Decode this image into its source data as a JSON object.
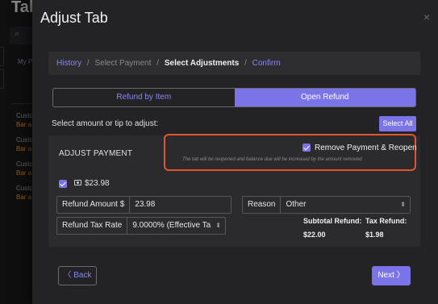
{
  "background": {
    "title": "Tal",
    "search_icon": "search-icon",
    "filter_label": "My P",
    "rows": [
      {
        "line1": "Custo",
        "line2": "Bar a"
      },
      {
        "line1": "Custo",
        "line2": "Bar a"
      },
      {
        "line1": "Custo",
        "line2": "Bar a"
      },
      {
        "line1": "Custo",
        "line2": "Bar a"
      }
    ]
  },
  "modal": {
    "title": "Adjust Tab",
    "close_icon": "×",
    "breadcrumb": {
      "history": "History",
      "sep": "/",
      "select_payment": "Select Payment",
      "select_adjustments": "Select Adjustments",
      "confirm": "Confirm"
    },
    "tabs": {
      "refund_by_item": "Refund by Item",
      "open_refund": "Open Refund",
      "active": "open_refund"
    },
    "select_prompt": "Select amount or tip to adjust:",
    "select_all": "Select All",
    "panel": {
      "heading": "ADJUST PAYMENT",
      "remove_reopen": {
        "label": "Remove Payment & Reopen",
        "checked": true,
        "note": "The tab will be reopened and balance due will be increased by the amount removed."
      },
      "payment": {
        "checked": true,
        "icon": "cash-icon",
        "amount": "$23.98"
      },
      "refund_amount": {
        "label": "Refund Amount $",
        "value": "23.98"
      },
      "refund_tax_rate": {
        "label": "Refund Tax Rate",
        "value": "9.0000% (Effective Ta"
      },
      "reason": {
        "label": "Reason",
        "value": "Other"
      },
      "subtotal_refund": {
        "label": "Subtotal Refund:",
        "value": "$22.00"
      },
      "tax_refund": {
        "label": "Tax Refund:",
        "value": "$1.98"
      }
    },
    "back": "Back",
    "next": "Next"
  },
  "colors": {
    "accent": "#7b74e8",
    "highlight": "#e0562e",
    "bar_text": "#d98a2b"
  }
}
